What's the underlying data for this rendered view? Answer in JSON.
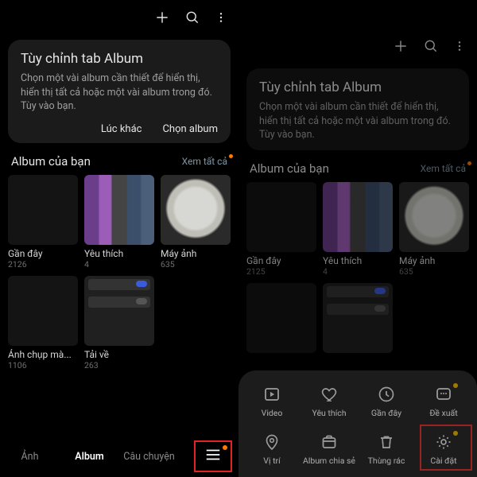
{
  "left": {
    "card": {
      "title": "Tùy chỉnh tab Album",
      "desc": "Chọn một vài album cần thiết để hiển thị, hiển thị tất cả hoặc một vài album trong đó. Tùy vào bạn.",
      "later": "Lúc khác",
      "choose": "Chọn album"
    },
    "section": {
      "title": "Album của bạn",
      "link": "Xem tất cả"
    },
    "albums": [
      {
        "label": "Gần đây",
        "count": "2126"
      },
      {
        "label": "Yêu thích",
        "count": "4"
      },
      {
        "label": "Máy ảnh",
        "count": "635"
      },
      {
        "label": "Ảnh chụp mà...",
        "count": "1106"
      },
      {
        "label": "Tải về",
        "count": "263"
      }
    ],
    "tabs": {
      "photos": "Ảnh",
      "album": "Album",
      "stories": "Câu chuyện"
    }
  },
  "right": {
    "card": {
      "title": "Tùy chỉnh tab Album",
      "desc": "Chọn một vài album cần thiết để hiển thị, hiển thị tất cả hoặc một vài album trong đó. Tùy vào bạn."
    },
    "section": {
      "title": "Album của bạn",
      "link": "Xem tất cả"
    },
    "albums": [
      {
        "label": "Gần đây",
        "count": "2125"
      },
      {
        "label": "Yêu thích",
        "count": "4"
      },
      {
        "label": "Máy ảnh",
        "count": "635"
      }
    ],
    "popup": [
      {
        "label": "Video"
      },
      {
        "label": "Yêu thích"
      },
      {
        "label": "Gần đây"
      },
      {
        "label": "Đề xuất"
      },
      {
        "label": "Vị trí"
      },
      {
        "label": "Album chia sẻ"
      },
      {
        "label": "Thùng rác"
      },
      {
        "label": "Cài đặt"
      }
    ]
  }
}
